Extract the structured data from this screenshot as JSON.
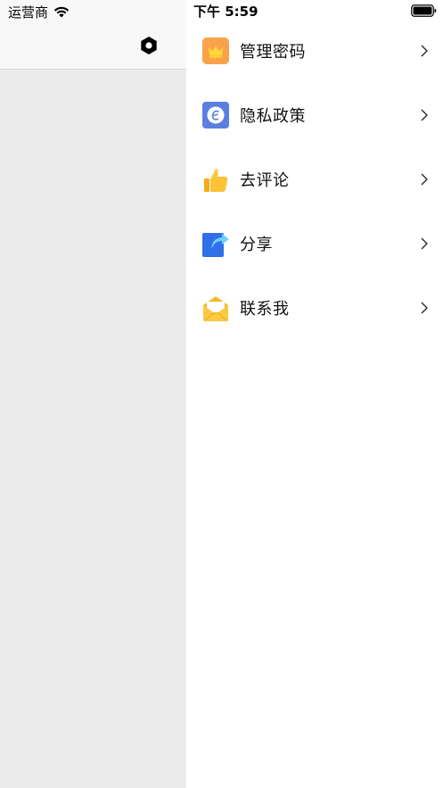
{
  "status_bar": {
    "carrier": "运营商",
    "time": "下午 5:59"
  },
  "main_page": {
    "background_color": "#ececec",
    "nav_icon": "settings-hexagon-icon"
  },
  "drawer": {
    "items": [
      {
        "label": "管理密码",
        "icon": "crown-icon",
        "icon_color": "#f9a24b"
      },
      {
        "label": "隐私政策",
        "icon": "privacy-icon",
        "icon_color": "#5b7fe0"
      },
      {
        "label": "去评论",
        "icon": "thumbs-up-icon",
        "icon_color": "#f8b521"
      },
      {
        "label": "分享",
        "icon": "share-icon",
        "icon_color": "#2f6fe8"
      },
      {
        "label": "联系我",
        "icon": "mail-icon",
        "icon_color": "#f5b82a"
      }
    ]
  }
}
